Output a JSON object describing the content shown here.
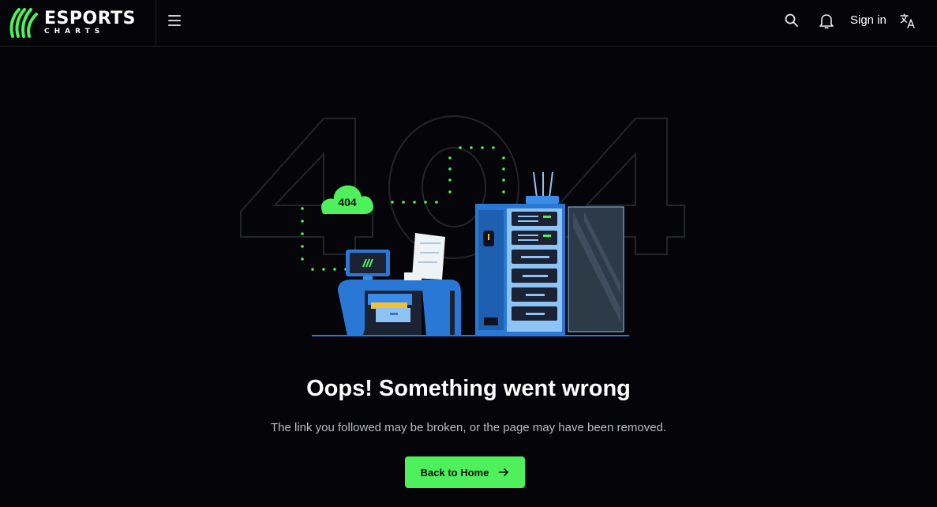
{
  "header": {
    "logo": {
      "word": "ESPORTS",
      "sub": "CHARTS",
      "mark_icon": "esports-charts-logo-icon"
    },
    "menu_icon": "hamburger-menu-icon",
    "search_icon": "search-icon",
    "bell_icon": "bell-icon",
    "signin_label": "Sign in",
    "language_icon": "translate-icon"
  },
  "illustration": {
    "cloud_label": "404",
    "background_digits": "404"
  },
  "main": {
    "title": "Oops! Something went wrong",
    "subtitle": "The link you followed may be broken, or the page may have been removed.",
    "home_button_label": "Back to Home",
    "home_button_icon": "arrow-right-icon"
  },
  "colors": {
    "accent": "#4ef15b",
    "background": "#050509",
    "illustration_blue": "#2a78d6",
    "illustration_dark": "#1b2233"
  }
}
